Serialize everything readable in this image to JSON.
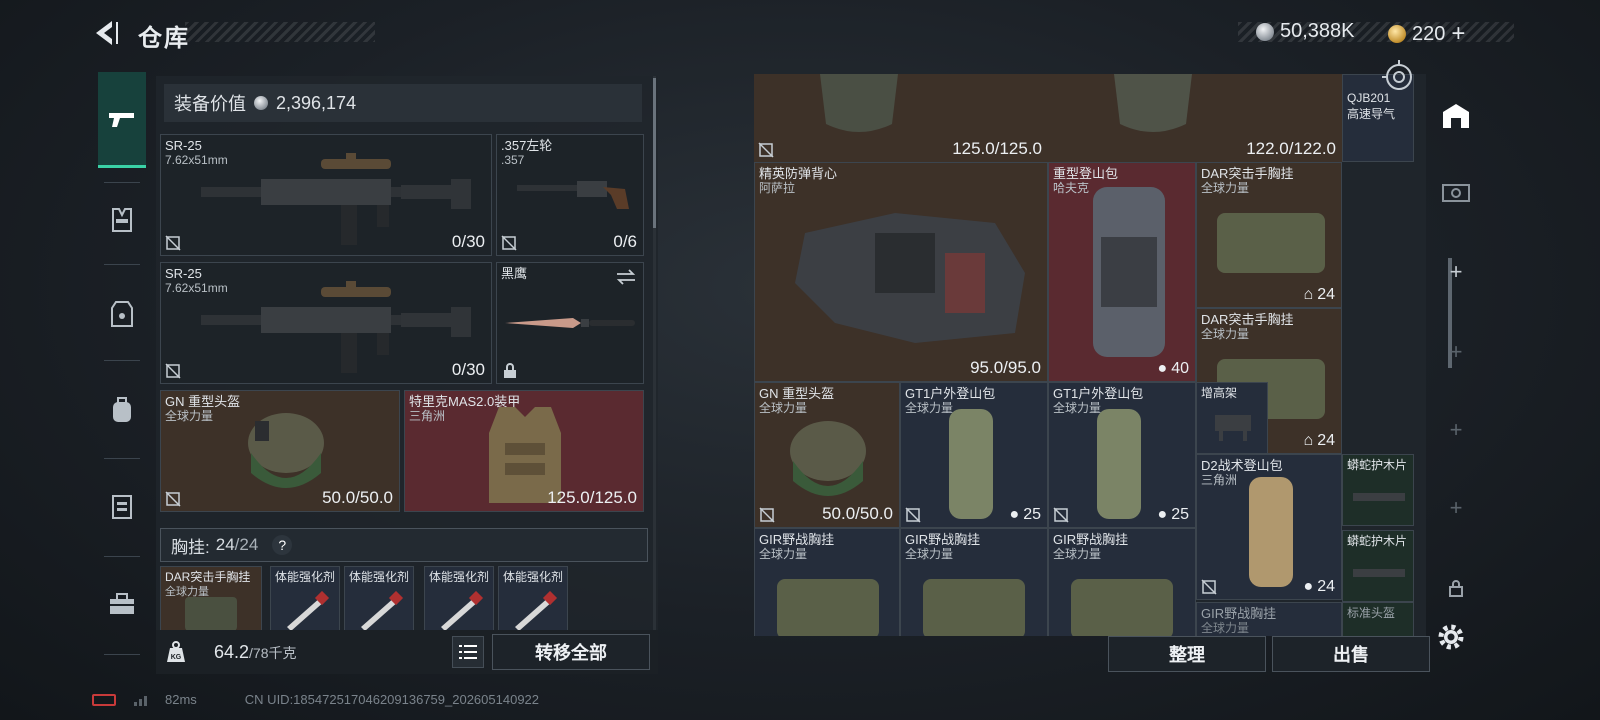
{
  "header": {
    "title": "仓库",
    "silver": "50,388K",
    "gold": "220"
  },
  "left_panel": {
    "equip_value_label": "装备价值",
    "equip_value": "2,396,174",
    "slots": [
      {
        "name": "SR-25",
        "sub": "7.62x51mm",
        "value": "0/30"
      },
      {
        "name": ".357左轮",
        "sub": ".357",
        "value": "0/6"
      },
      {
        "name": "SR-25",
        "sub": "7.62x51mm",
        "value": "0/30"
      },
      {
        "name": "黑鹰",
        "sub": ""
      },
      {
        "name": "GN 重型头盔",
        "sub": "全球力量",
        "value": "50.0/50.0"
      },
      {
        "name": "特里克MAS2.0装甲",
        "sub": "三角洲",
        "value": "125.0/125.0"
      }
    ],
    "chest_label": "胸挂:",
    "chest_value": "24",
    "chest_max": "/24",
    "chest_help": "?",
    "chest_items": [
      {
        "name": "DAR突击手胸挂",
        "sub": "全球力量"
      },
      {
        "name": "体能强化剂"
      },
      {
        "name": "体能强化剂"
      },
      {
        "name": "体能强化剂"
      },
      {
        "name": "体能强化剂"
      }
    ]
  },
  "bottom_left": {
    "weight": "64.2",
    "weight_max": "/78千克",
    "weight_icon_text": "KG",
    "transfer_all": "转移全部"
  },
  "right_panel": {
    "items": [
      {
        "id": "top1",
        "value": "125.0/125.0"
      },
      {
        "id": "top2",
        "value": "122.0/122.0"
      },
      {
        "id": "qjb",
        "name": "QJB201",
        "sub": "高速导气"
      },
      {
        "id": "vest",
        "name": "精英防弹背心",
        "sub": "阿萨拉",
        "value": "95.0/95.0"
      },
      {
        "id": "pack",
        "name": "重型登山包",
        "sub": "哈夫克",
        "value": "40"
      },
      {
        "id": "dar1",
        "name": "DAR突击手胸挂",
        "sub": "全球力量",
        "value": "24"
      },
      {
        "id": "dar2",
        "name": "DAR突击手胸挂",
        "sub": "全球力量",
        "value": "24"
      },
      {
        "id": "helmet",
        "name": "GN 重型头盔",
        "sub": "全球力量",
        "value": "50.0/50.0"
      },
      {
        "id": "gt1a",
        "name": "GT1户外登山包",
        "sub": "全球力量",
        "value": "25"
      },
      {
        "id": "gt1b",
        "name": "GT1户外登山包",
        "sub": "全球力量",
        "value": "25"
      },
      {
        "id": "riser",
        "name": "增高架"
      },
      {
        "id": "d2",
        "name": "D2战术登山包",
        "sub": "三角洲",
        "value": "24"
      },
      {
        "id": "snake1",
        "name": "蟒蛇护木片"
      },
      {
        "id": "snake2",
        "name": "蟒蛇护木片"
      },
      {
        "id": "gir1",
        "name": "GIR野战胸挂",
        "sub": "全球力量"
      },
      {
        "id": "gir2",
        "name": "GIR野战胸挂",
        "sub": "全球力量"
      },
      {
        "id": "gir3",
        "name": "GIR野战胸挂",
        "sub": "全球力量"
      },
      {
        "id": "gir4",
        "name": "GIR野战胸挂",
        "sub": "全球力量"
      },
      {
        "id": "std",
        "name": "标准头盔"
      }
    ]
  },
  "bottom_right": {
    "sort": "整理",
    "sell": "出售"
  },
  "footer": {
    "ping": "82ms",
    "uid": "CN UID:185472517046209136759_202605140922"
  },
  "colors": {
    "accent": "#3ad1a6",
    "brown_slot": "#3d3128",
    "red_slot": "#5a2a30",
    "blue_slot": "#252d3b",
    "green_slot": "#1e2e28"
  }
}
